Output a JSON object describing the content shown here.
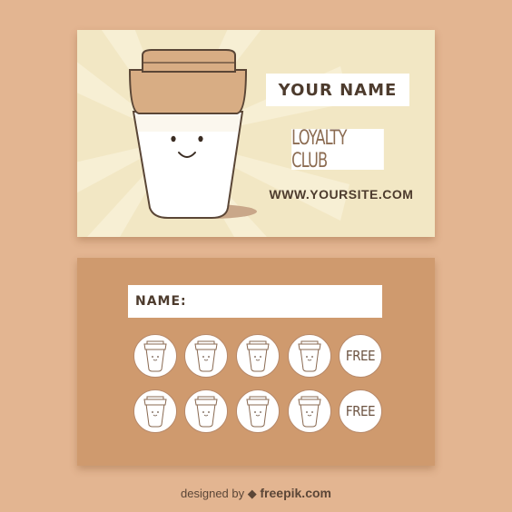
{
  "front": {
    "name": "YOUR NAME",
    "club": "LOYALTY CLUB",
    "website": "WWW.YOURSITE.COM"
  },
  "back": {
    "name_label": "NAME:",
    "stamps": [
      {
        "kind": "cup"
      },
      {
        "kind": "cup"
      },
      {
        "kind": "cup"
      },
      {
        "kind": "cup"
      },
      {
        "kind": "free",
        "label": "FREE"
      },
      {
        "kind": "cup"
      },
      {
        "kind": "cup"
      },
      {
        "kind": "cup"
      },
      {
        "kind": "cup"
      },
      {
        "kind": "free",
        "label": "FREE"
      }
    ]
  },
  "credit": {
    "prefix": "designed by",
    "brand": "freepik.com",
    "icon": "freepik-logo-icon"
  },
  "colors": {
    "background": "#e3b591",
    "front_card": "#f2e7c4",
    "back_card": "#cf9a6e",
    "cup_lid": "#d8ad84",
    "text_dark": "#4d3b2d"
  }
}
